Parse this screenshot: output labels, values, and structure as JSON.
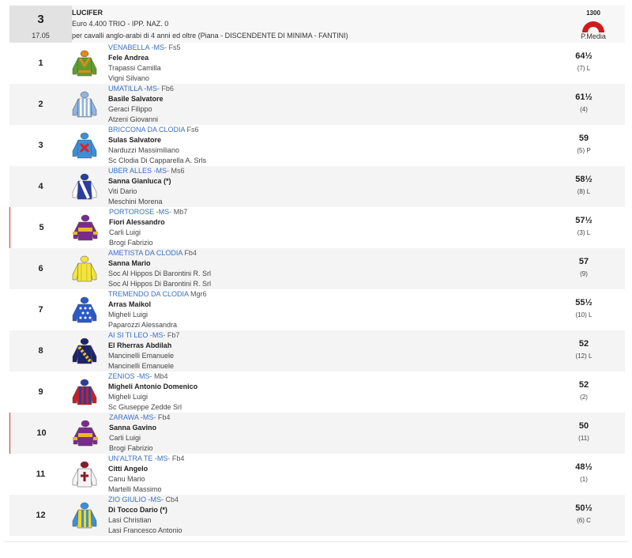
{
  "race": {
    "number": "3",
    "time": "17.05",
    "name": "LUCIFER",
    "prize": "Euro 4.400 TRIO - IPP. NAZ. 0",
    "conditions": "per cavalli anglo-arabi di 4 anni ed oltre (Piana -  DISCENDENTE DI MINIMA  - FANTINI)",
    "distance": "1300",
    "pmedia_label": "P.Media",
    "distance_color": "#d11a1a"
  },
  "runners": [
    {
      "num": "1",
      "horse": "VENABELLA -MS-",
      "form": "Fs5",
      "jockey": "Fele Andrea",
      "trainer": "Trapassi Camilla",
      "owner": "Vigni Silvano",
      "weight": "64½",
      "pos": "(7) L",
      "silk": "silk-green-orange-icon",
      "flag": false
    },
    {
      "num": "2",
      "horse": "UMATILLA -MS-",
      "form": "Fb6",
      "jockey": "Basile Salvatore",
      "trainer": "Geraci Filippo",
      "owner": "Atzeni Giovanni",
      "weight": "61½",
      "pos": "(4)",
      "silk": "silk-blue-white-stripes-icon",
      "flag": false
    },
    {
      "num": "3",
      "horse": "BRICCONA DA CLODIA",
      "form": "Fs6",
      "jockey": "Sulas Salvatore",
      "trainer": "Narduzzi Massimiliano",
      "owner": "Sc Clodia Di Capparella A. Srls",
      "weight": "59",
      "pos": "(5) P",
      "silk": "silk-blue-red-cross-icon",
      "flag": false
    },
    {
      "num": "4",
      "horse": "UBER ALLES -MS-",
      "form": "Ms6",
      "jockey": "Sanna Gianluca (*)",
      "trainer": "Viti Dario",
      "owner": "Meschini Morena",
      "weight": "58½",
      "pos": "(8) L",
      "silk": "silk-navy-white-sash-icon",
      "flag": false
    },
    {
      "num": "5",
      "horse": "PORTOROSE -MS-",
      "form": "Mb7",
      "jockey": "Fiori Alessandro",
      "trainer": "Carli Luigi",
      "owner": "Brogi Fabrizio",
      "weight": "57½",
      "pos": "(3) L",
      "silk": "silk-purple-yellow-icon",
      "flag": true
    },
    {
      "num": "6",
      "horse": "AMETISTA DA CLODIA",
      "form": "Fb4",
      "jockey": "Sanna Mario",
      "trainer": "Soc Al Hippos Di Barontini R. Srl",
      "owner": "Soc Al Hippos Di Barontini R. Srl",
      "weight": "57",
      "pos": "(9)",
      "silk": "silk-yellow-icon",
      "flag": false
    },
    {
      "num": "7",
      "horse": "TREMENDO DA CLODIA",
      "form": "Mgr6",
      "jockey": "Arras Maikol",
      "trainer": "Migheli Luigi",
      "owner": "Paparozzi Alessandra",
      "weight": "55½",
      "pos": "(10) L",
      "silk": "silk-blue-white-stars-icon",
      "flag": false
    },
    {
      "num": "8",
      "horse": "AI SI TI LEO -MS-",
      "form": "Fb7",
      "jockey": "El Rherras Abdilah",
      "trainer": "Mancinelli Emanuele",
      "owner": "Mancinelli Emanuele",
      "weight": "52",
      "pos": "(12) L",
      "silk": "silk-navy-yellow-diamonds-icon",
      "flag": false
    },
    {
      "num": "9",
      "horse": "ZENIOS -MS-",
      "form": "Mb4",
      "jockey": "Migheli Antonio Domenico",
      "trainer": "Migheli Luigi",
      "owner": "Sc Giuseppe Zedde Srl",
      "weight": "52",
      "pos": "(2)",
      "silk": "silk-red-blue-stripes-icon",
      "flag": false
    },
    {
      "num": "10",
      "horse": "ZARAWA -MS-",
      "form": "Fb4",
      "jockey": "Sanna Gavino",
      "trainer": "Carli Luigi",
      "owner": "Brogi Fabrizio",
      "weight": "50",
      "pos": "(11)",
      "silk": "silk-purple-yellow-icon",
      "flag": true
    },
    {
      "num": "11",
      "horse": "UN'ALTRA TE -MS-",
      "form": "Fb4",
      "jockey": "Citti Angelo",
      "trainer": "Canu Mario",
      "owner": "Martelli Massimo",
      "weight": "48½",
      "pos": "(1)",
      "silk": "silk-white-maroon-cross-icon",
      "flag": false
    },
    {
      "num": "12",
      "horse": "ZIO GIULIO -MS-",
      "form": "Cb4",
      "jockey": "Di Tocco Dario (*)",
      "trainer": "Lasi Christian",
      "owner": "Lasi Francesco Antonio",
      "weight": "50½",
      "pos": "(6) C",
      "silk": "silk-yellow-blue-stripes-icon",
      "flag": false
    }
  ]
}
